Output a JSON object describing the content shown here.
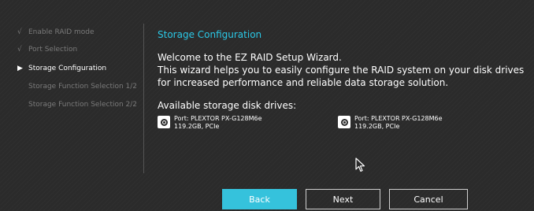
{
  "sidebar": {
    "items": [
      {
        "mark": "√",
        "label": "Enable RAID mode"
      },
      {
        "mark": "√",
        "label": "Port Selection"
      },
      {
        "mark": "▶",
        "label": "Storage Configuration"
      },
      {
        "mark": "",
        "label": "Storage Function Selection 1/2"
      },
      {
        "mark": "",
        "label": "Storage Function Selection 2/2"
      }
    ]
  },
  "main": {
    "title": "Storage Configuration",
    "welcome": "Welcome to the EZ RAID Setup Wizard.",
    "desc_line1": "This wizard helps you to easily configure the RAID system on your disk drives",
    "desc_line2": "for increased performance and reliable data storage solution.",
    "available_label": "Available storage disk drives:",
    "drives": [
      {
        "port": "Port: PLEXTOR PX-G128M6e",
        "spec": "119.2GB, PCIe",
        "icon": "disk-drive-icon"
      },
      {
        "port": "Port: PLEXTOR PX-G128M6e",
        "spec": "119.2GB, PCIe",
        "icon": "disk-drive-icon"
      }
    ]
  },
  "buttons": {
    "back": "Back",
    "next": "Next",
    "cancel": "Cancel"
  },
  "colors": {
    "accent": "#2bc8e6",
    "back_button": "#35c2dc",
    "background": "#2b2b2b"
  }
}
